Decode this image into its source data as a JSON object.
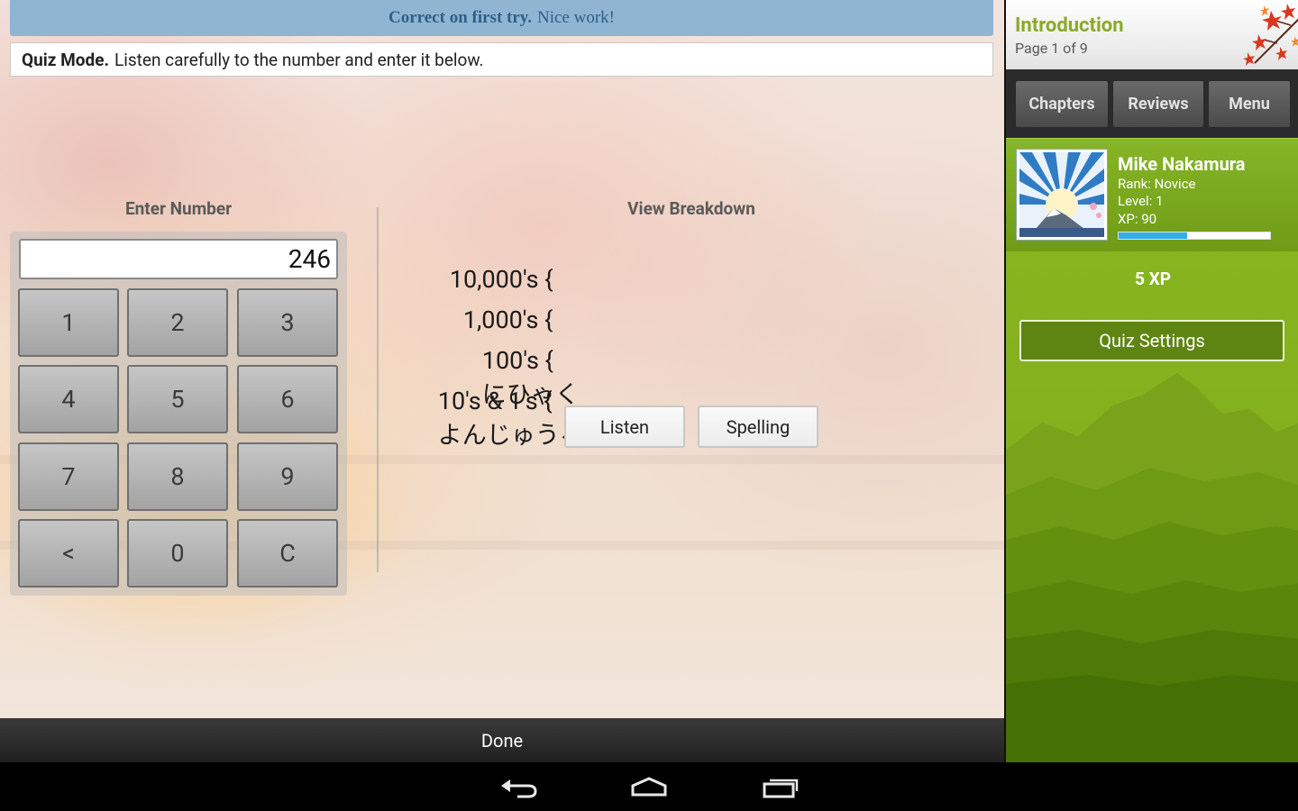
{
  "banner": {
    "bold": "Correct on first try.",
    "text": "Nice work!"
  },
  "instructions": {
    "bold": "Quiz Mode.",
    "text": "Listen carefully to the number and enter it below."
  },
  "enter_section": {
    "title": "Enter Number",
    "value": "246"
  },
  "keypad": {
    "k1": "1",
    "k2": "2",
    "k3": "3",
    "k4": "4",
    "k5": "5",
    "k6": "6",
    "k7": "7",
    "k8": "8",
    "k9": "9",
    "back": "<",
    "k0": "0",
    "clear": "C"
  },
  "breakdown": {
    "title": "View Breakdown",
    "rows": [
      {
        "label": "10,000's {",
        "reading": ""
      },
      {
        "label": "1,000's {",
        "reading": ""
      },
      {
        "label": "100's {",
        "reading": "にひゃく"
      },
      {
        "label": "10's & 1's {",
        "reading": "よんじゅうろく"
      }
    ],
    "listen_label": "Listen",
    "spelling_label": "Spelling"
  },
  "done_label": "Done",
  "sidebar": {
    "title": "Introduction",
    "page": "Page 1 of 9",
    "nav": {
      "chapters": "Chapters",
      "reviews": "Reviews",
      "menu": "Menu"
    },
    "profile": {
      "name": "Mike Nakamura",
      "rank": "Rank: Novice",
      "level": "Level: 1",
      "xp": "XP: 90",
      "xp_progress": 0.45
    },
    "xp_reward": "5 XP",
    "quiz_settings_label": "Quiz Settings"
  },
  "colors": {
    "banner_bg": "#8fb5d3",
    "banner_text": "#2e5f88",
    "sidebar_green": "#87b51f",
    "title_green": "#8ba92a",
    "xp_bar": "#33aee8"
  },
  "icons": {
    "back": "back-arrow-icon",
    "home": "home-icon",
    "recents": "recent-apps-icon"
  }
}
